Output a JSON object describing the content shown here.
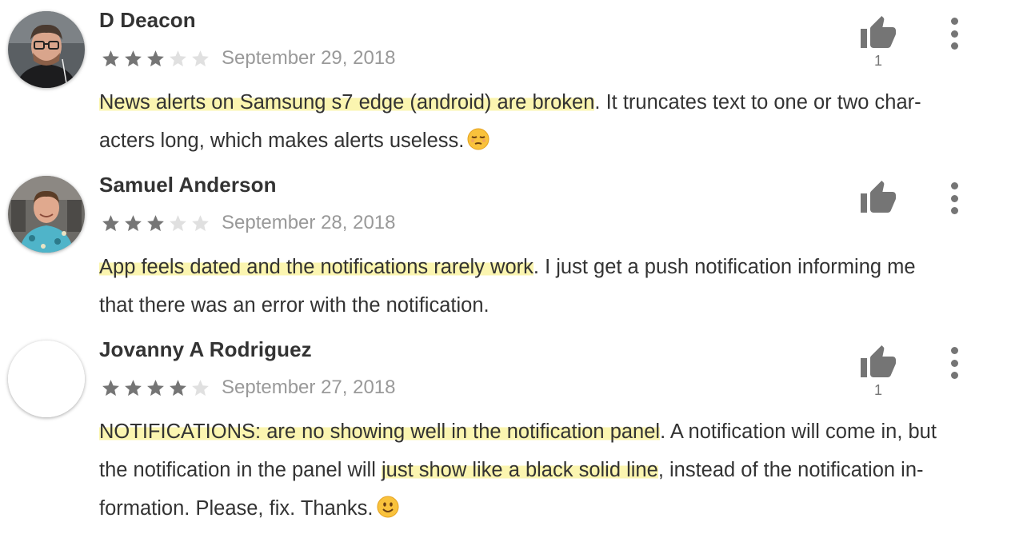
{
  "reviews": [
    {
      "author": "D Deacon",
      "rating": 3,
      "date": "September 29, 2018",
      "likes": "1",
      "body_lines": [
        {
          "highlight": "News alerts on Samsung s7 edge (android) are broken",
          "rest": ". It truncates text to one or two char-"
        },
        {
          "plain": "acters long, which makes alerts useless.",
          "emoji": "unamused-face"
        }
      ]
    },
    {
      "author": "Samuel Anderson",
      "rating": 3,
      "date": "September 28, 2018",
      "likes": "",
      "body_lines": [
        {
          "highlight": "App feels dated and the notifications rarely work",
          "rest": ". I just get a push notification informing me"
        },
        {
          "plain": "that there was an error with the notification."
        }
      ]
    },
    {
      "author": "Jovanny A Rodriguez",
      "rating": 4,
      "date": "September 27, 2018",
      "likes": "1",
      "body_lines": [
        {
          "highlight": "NOTIFICATIONS: are no showing well in the notification panel",
          "rest": ". A notification will come in, but"
        },
        {
          "pre": "the notification in the panel will ",
          "highlight2": "just show like a black solid line",
          "post": ", instead of the notification in-"
        },
        {
          "plain": "formation. Please, fix. Thanks.",
          "emoji": "slightly-smiling-face"
        }
      ]
    }
  ],
  "icons": {
    "like": "thumbs-up-icon",
    "menu": "more-vert-icon",
    "star": "star-icon"
  },
  "colors": {
    "star_filled": "#757575",
    "star_empty": "#e0e0e0",
    "highlight": "#fbf5b0",
    "icon": "#757575"
  }
}
